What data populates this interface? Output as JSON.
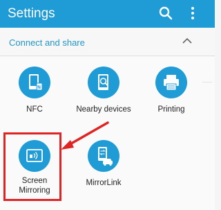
{
  "appbar": {
    "title": "Settings",
    "search_icon": "search-icon",
    "more_icon": "more-vert-icon"
  },
  "section": {
    "title": "Connect and share",
    "collapse_icon": "chevron-up-icon"
  },
  "tiles": [
    {
      "label": "NFC",
      "icon": "nfc-icon"
    },
    {
      "label": "Nearby devices",
      "icon": "nearby-devices-icon"
    },
    {
      "label": "Printing",
      "icon": "printer-icon"
    },
    {
      "label_line1": "Screen",
      "label_line2": "Mirroring",
      "icon": "screen-mirroring-icon"
    },
    {
      "label": "MirrorLink",
      "icon": "mirrorlink-icon"
    }
  ],
  "colors": {
    "appbar": "#1f9bd6",
    "accent": "#2196c9",
    "highlight": "#e02424"
  }
}
